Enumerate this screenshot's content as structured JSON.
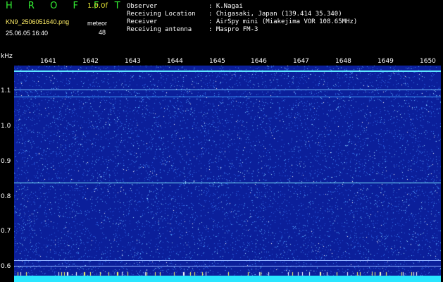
{
  "header": {
    "title": "H R O F F T",
    "version": "1.0.0f",
    "filename": "KN9_2506051640.png",
    "datetime": "25.06.05 16:40",
    "meteor_label": "meteor",
    "meteor_count": "48"
  },
  "info": {
    "observer_label": "Observer",
    "observer": ": K.Nagai",
    "location_label": "Receiving Location",
    "location": ": Chigasaki, Japan (139.414 35.340)",
    "receiver_label": "Receiver",
    "receiver": ": AirSpy mini (Miakejima VOR 108.65MHz)",
    "antenna_label": "Receiving antenna",
    "antenna": ": Maspro FM-3"
  },
  "axis": {
    "unit": "kHz",
    "time_ticks": [
      "1641",
      "1642",
      "1643",
      "1644",
      "1645",
      "1646",
      "1647",
      "1648",
      "1649",
      "1650"
    ],
    "freq_ticks": [
      "1.1",
      "1.0",
      "0.9",
      "0.8",
      "0.7",
      "0.6"
    ]
  },
  "colors": {
    "background": "#0b1f9a",
    "signal": "#27e5ff",
    "noise": "#ffffff",
    "title": "#33ee33"
  }
}
